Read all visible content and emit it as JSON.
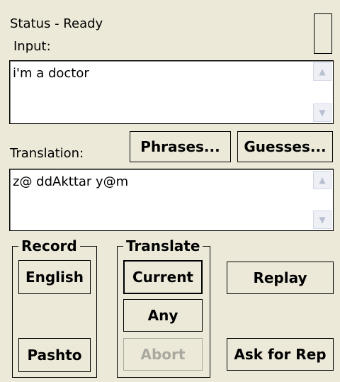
{
  "status": {
    "text": "Status - Ready"
  },
  "input": {
    "label": "Input:",
    "value": "i'm a doctor"
  },
  "translation": {
    "label": "Translation:",
    "value": "z@ ddAkttar y@m"
  },
  "buttons": {
    "phrases": "Phrases...",
    "guesses": "Guesses...",
    "english": "English",
    "pashto": "Pashto",
    "current": "Current",
    "any": "Any",
    "abort": "Abort",
    "replay": "Replay",
    "ask_for_rep": "Ask for Rep"
  },
  "groups": {
    "record": "Record",
    "translate": "Translate"
  },
  "scroll_icons": {
    "up": "▲",
    "down": "▼"
  },
  "colors": {
    "background": "#ece9d8",
    "disabled_text": "#a9a9a0",
    "scroll_arrow": "#b7bfd1"
  }
}
